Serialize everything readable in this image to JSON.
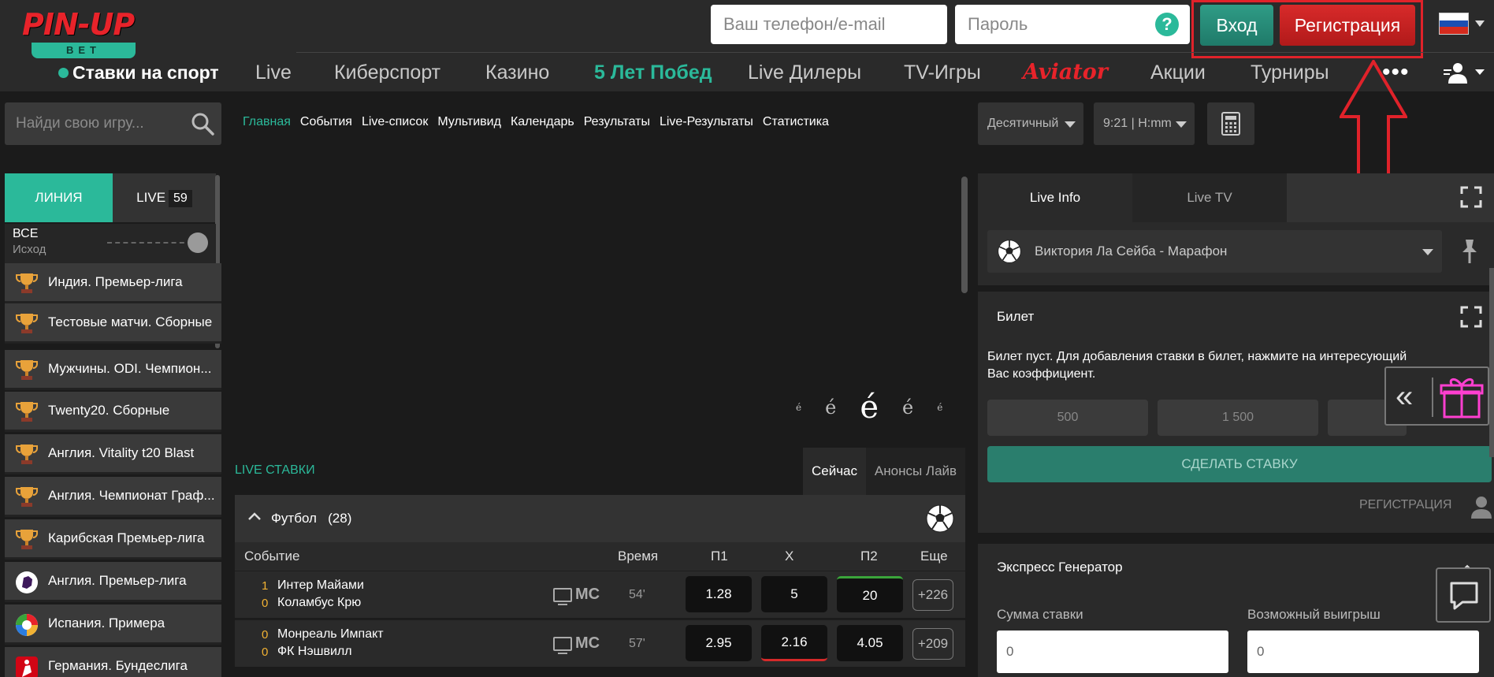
{
  "logo": {
    "main": "PIN-UP",
    "sub": "BET"
  },
  "auth": {
    "phone_placeholder": "Ваш телефон/e-mail",
    "password_placeholder": "Пароль",
    "help": "?",
    "login": "Вход",
    "register": "Регистрация"
  },
  "nav": {
    "sport": "Ставки на спорт",
    "items": [
      "Live",
      "Киберспорт",
      "Казино",
      "5 Лет Побед",
      "Live Дилеры",
      "TV-Игры",
      "Aviator",
      "Акции",
      "Турниры"
    ],
    "more": "•••"
  },
  "search": {
    "placeholder": "Найди свою игру..."
  },
  "sidebar": {
    "tab_line": "ЛИНИЯ",
    "tab_live": "LIVE",
    "live_count": "59",
    "filter_all": "ВСЕ",
    "filter_sub": "Исход",
    "leagues": [
      "Индия. Премьер-лига",
      "Тестовые матчи. Сборные",
      "Мужчины. ODI. Чемпион...",
      "Twenty20. Сборные",
      "Англия. Vitality t20 Blast",
      "Англия. Чемпионат Граф...",
      "Карибская Премьер-лига",
      "Англия. Премьер-лига",
      "Испания. Примера",
      "Германия. Бундеслига"
    ]
  },
  "breadcrumb": [
    "Главная",
    "События",
    "Live-список",
    "Мультивид",
    "Календарь",
    "Результаты",
    "Live-Результаты",
    "Статистика"
  ],
  "glyphs": [
    "é",
    "é",
    "é",
    "é",
    "é"
  ],
  "live": {
    "title": "LIVE СТАВКИ",
    "tab_now": "Сейчас",
    "tab_announce": "Анонсы Лайв",
    "sport": "Футбол",
    "sport_count": "(28)",
    "columns": {
      "event": "Событие",
      "time": "Время",
      "p1": "П1",
      "x": "X",
      "p2": "П2",
      "more": "Еще"
    },
    "mc": "MC",
    "events": [
      {
        "score1": "1",
        "team1": "Интер Майами",
        "score2": "0",
        "team2": "Коламбус Крю",
        "time": "54'",
        "p1": "1.28",
        "x": "5",
        "p2": "20",
        "more": "+226"
      },
      {
        "score1": "0",
        "team1": "Монреаль Импакт",
        "score2": "0",
        "team2": "ФК Нэшвилл",
        "time": "57'",
        "p1": "2.95",
        "x": "2.16",
        "p2": "4.05",
        "more": "+209"
      }
    ]
  },
  "right": {
    "odds_format": "Десятичный",
    "time_format": "9:21 | H:mm",
    "tab_info": "Live Info",
    "tab_tv": "Live TV",
    "match": "Виктория Ла Сейба - Марафон",
    "ticket_title": "Билет",
    "ticket_msg": "Билет пуст. Для добавления ставки в билет, нажмите на интересующий Вас коэффициент.",
    "stakes": [
      "500",
      "1 500"
    ],
    "make_bet": "СДЕЛАТЬ СТАВКУ",
    "register": "РЕГИСТРАЦИЯ",
    "express_title": "Экспресс Генератор",
    "stake_sum": "Сумма ставки",
    "possible_win": "Возможный выигрыш",
    "stake_value": "0",
    "win_value": "0"
  },
  "colors": {
    "accent": "#2bb99a",
    "brand_red": "#e8232a",
    "highlight": "#e0222a"
  }
}
